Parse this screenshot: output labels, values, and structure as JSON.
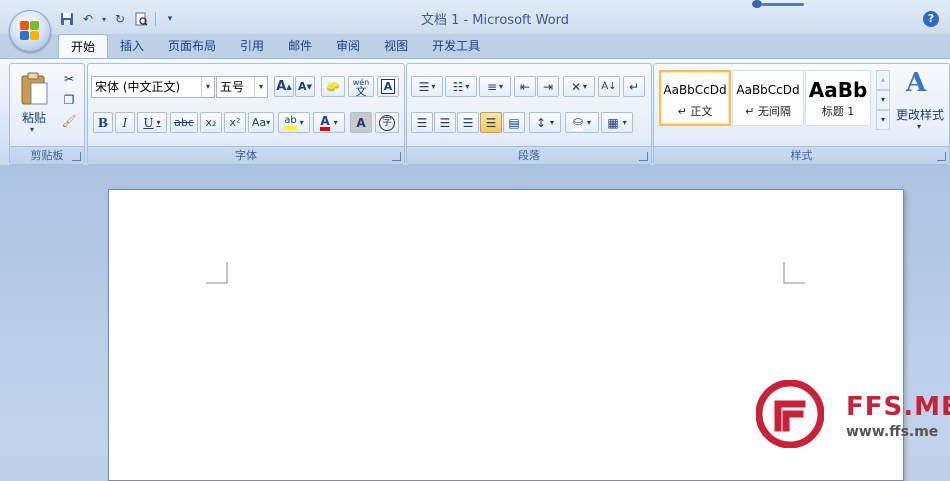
{
  "window": {
    "title": "文档 1 - Microsoft Word"
  },
  "colors": {
    "accent": "#15428b",
    "brand_red": "#c7223a"
  },
  "tabs": [
    {
      "label": "开始",
      "active": true
    },
    {
      "label": "插入"
    },
    {
      "label": "页面布局"
    },
    {
      "label": "引用"
    },
    {
      "label": "邮件"
    },
    {
      "label": "审阅"
    },
    {
      "label": "视图"
    },
    {
      "label": "开发工具"
    }
  ],
  "clipboard": {
    "label": "剪贴板",
    "paste_label": "粘贴"
  },
  "font": {
    "label": "字体",
    "family": "宋体 (中文正文)",
    "size": "五号",
    "bold": "B",
    "italic": "I",
    "underline": "U",
    "strike": "abc",
    "subscript": "x₂",
    "superscript": "x²",
    "case": "Aa",
    "grow": "A",
    "shrink": "A",
    "wen": "wén",
    "wen_char": "文",
    "border_char": "A",
    "shade_char": "A",
    "enclose_char": "字",
    "color_char": "A"
  },
  "paragraph": {
    "label": "段落"
  },
  "styles": {
    "label": "样式",
    "items": [
      {
        "sample": "AaBbCcDd",
        "name": "↵ 正文",
        "selected": true
      },
      {
        "sample": "AaBbCcDd",
        "name": "↵ 无间隔"
      },
      {
        "sample": "AaBb",
        "name": "标题 1"
      }
    ],
    "change_label": "更改样式"
  },
  "branding": {
    "name": "FFS.ME",
    "url": "www.ffs.me"
  }
}
